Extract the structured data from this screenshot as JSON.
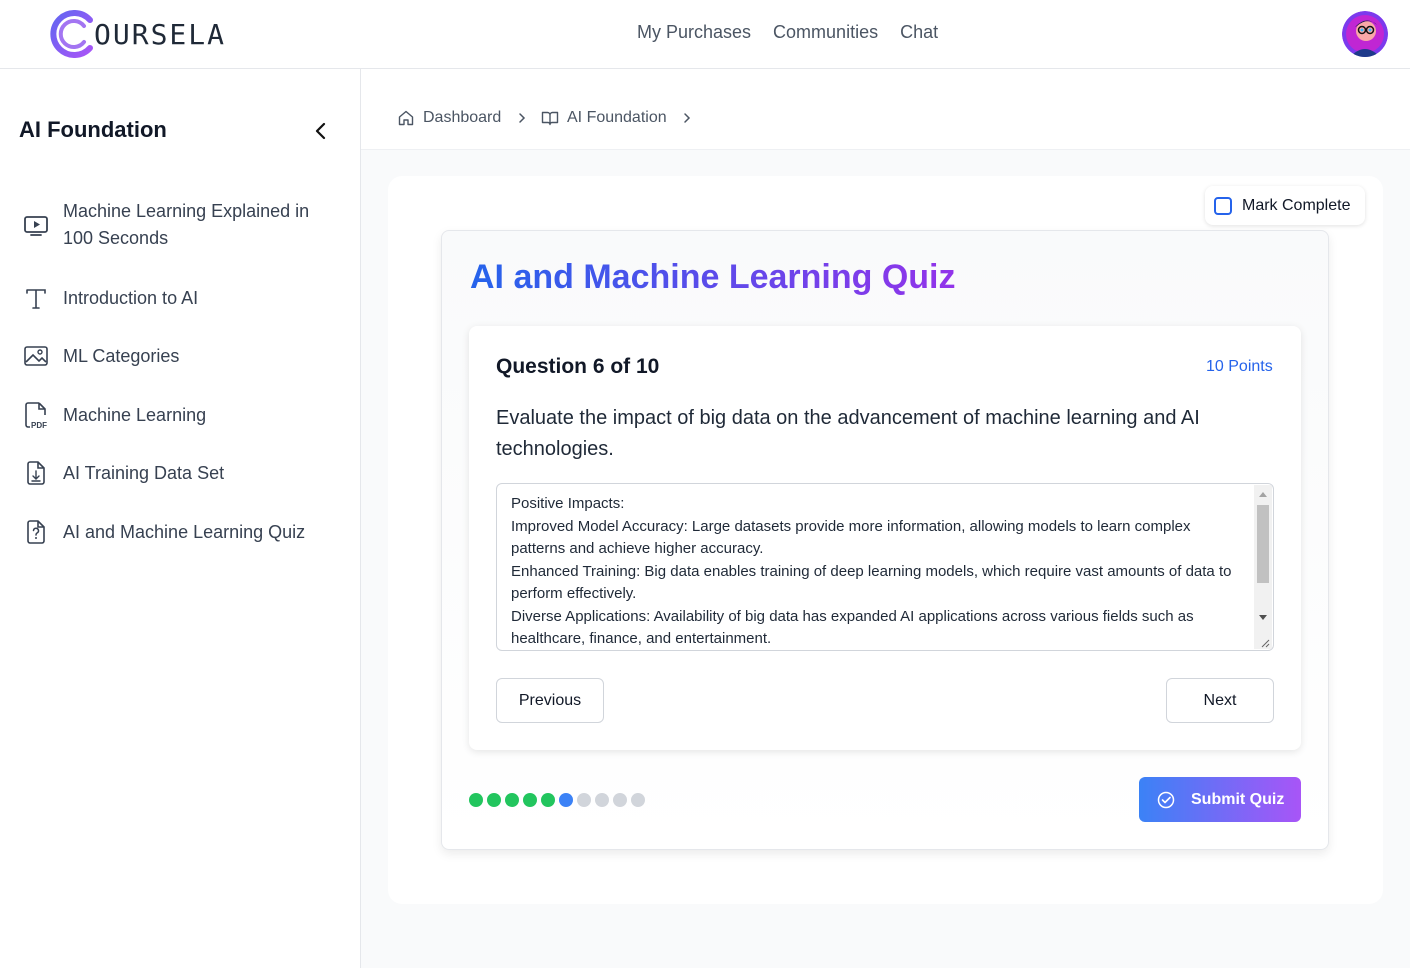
{
  "brand": {
    "logo_text": "OURSELA"
  },
  "topnav": {
    "items": [
      "My Purchases",
      "Communities",
      "Chat"
    ]
  },
  "sidebar": {
    "title": "AI Foundation",
    "items": [
      {
        "label": "Machine Learning Explained in 100 Seconds",
        "icon": "video-icon"
      },
      {
        "label": "Introduction to AI",
        "icon": "text-icon"
      },
      {
        "label": "ML Categories",
        "icon": "image-icon"
      },
      {
        "label": "Machine Learning",
        "icon": "pdf-icon"
      },
      {
        "label": "AI Training Data Set",
        "icon": "file-download-icon"
      },
      {
        "label": "AI and Machine Learning Quiz",
        "icon": "quiz-icon"
      }
    ]
  },
  "breadcrumb": {
    "items": [
      "Dashboard",
      "AI Foundation"
    ]
  },
  "mark_complete": {
    "label": "Mark Complete",
    "checked": false
  },
  "quiz": {
    "title": "AI and Machine Learning Quiz",
    "question_label": "Question 6 of 10",
    "points": "10 Points",
    "question_text": "Evaluate the impact of big data on the advancement of machine learning and AI technologies.",
    "answer_lines": [
      "Positive Impacts:",
      "Improved Model Accuracy: Large datasets provide more information, allowing models to learn complex patterns and achieve higher accuracy.",
      "Enhanced Training: Big data enables training of deep learning models, which require vast amounts of data to perform effectively.",
      "Diverse Applications: Availability of big data has expanded AI applications across various fields such as healthcare, finance, and entertainment."
    ],
    "previous_label": "Previous",
    "next_label": "Next",
    "submit_label": "Submit Quiz",
    "progress": [
      "answered",
      "answered",
      "answered",
      "answered",
      "answered",
      "current",
      "unanswered",
      "unanswered",
      "unanswered",
      "unanswered"
    ]
  },
  "colors": {
    "answered": "#22c55e",
    "current": "#3b82f6",
    "unanswered": "#d1d5db",
    "accent": "#2563eb"
  }
}
